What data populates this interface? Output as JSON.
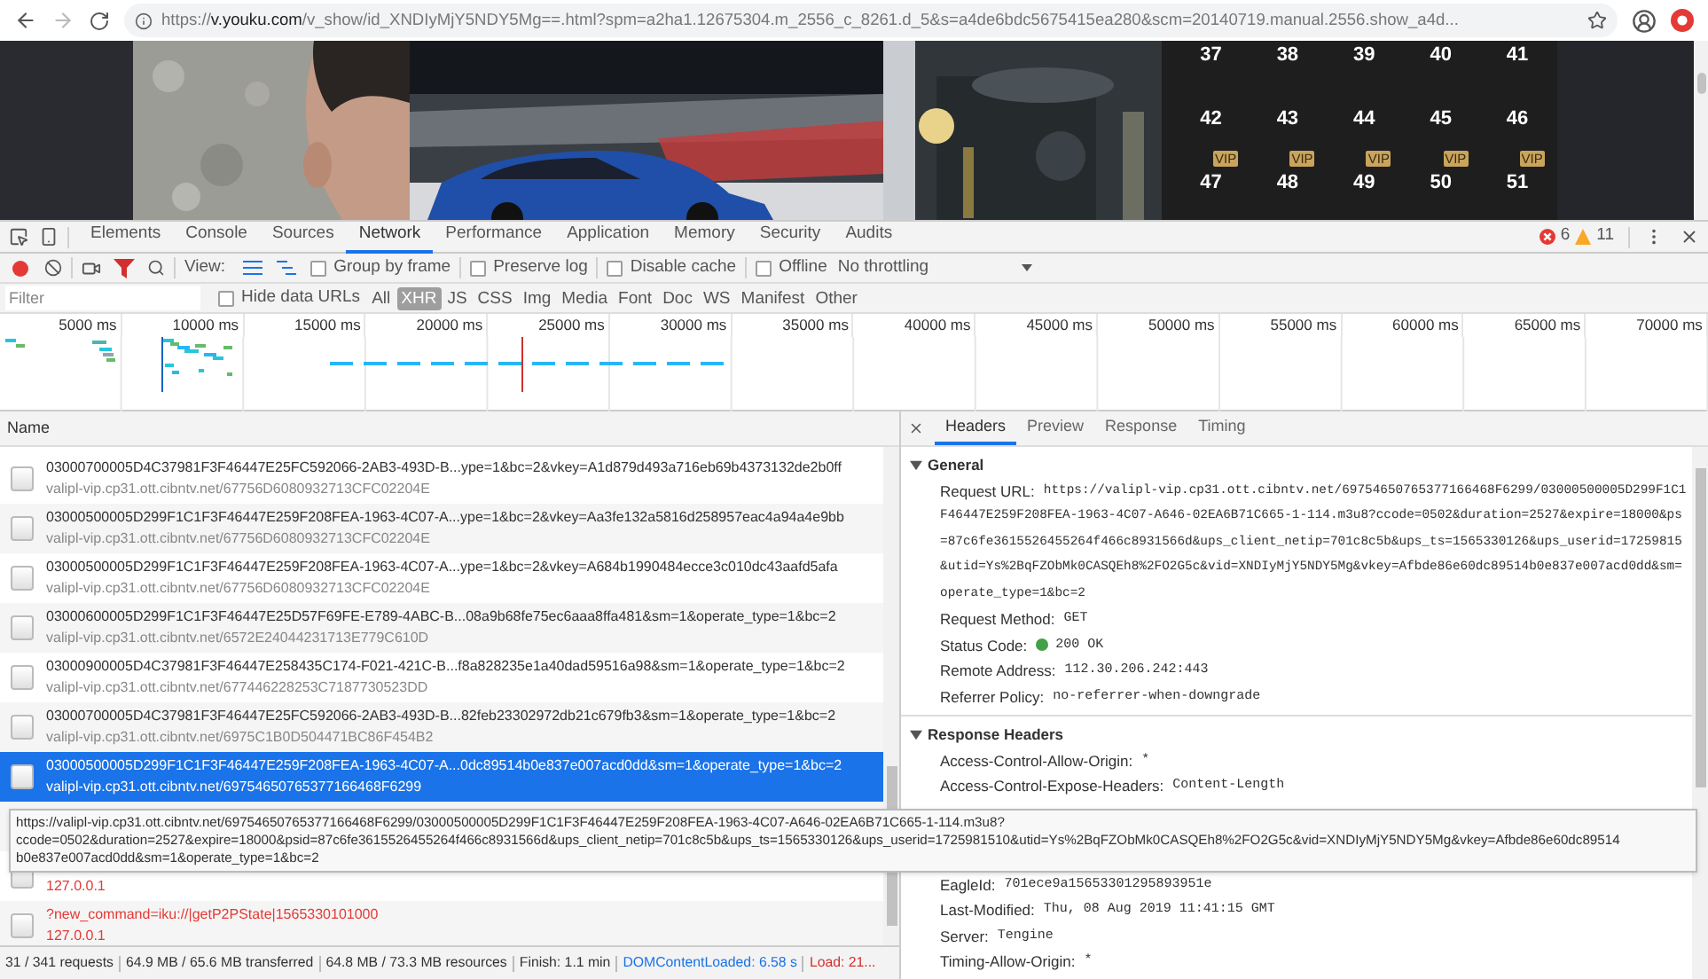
{
  "browser": {
    "url": {
      "scheme": "https://",
      "host": "v.youku.com",
      "rest": "/v_show/id_XNDIyMjY5NDY5Mg==.html?spm=a2ha1.12675304.m_2556_c_8261.d_5&s=a4de6bdc5675415ea280&scm=20140719.manual.2556.show_a4d..."
    }
  },
  "page": {
    "episodes": [
      {
        "number": "37"
      },
      {
        "number": "38"
      },
      {
        "number": "39"
      },
      {
        "number": "40"
      },
      {
        "number": "41"
      },
      {
        "number": "42"
      },
      {
        "number": "43"
      },
      {
        "number": "44"
      },
      {
        "number": "45"
      },
      {
        "number": "46"
      },
      {
        "number": "47",
        "badge": "VIP"
      },
      {
        "number": "48",
        "badge": "VIP"
      },
      {
        "number": "49",
        "badge": "VIP"
      },
      {
        "number": "50",
        "badge": "VIP"
      },
      {
        "number": "51",
        "badge": "VIP"
      }
    ]
  },
  "devtools": {
    "tabs": [
      {
        "label": "Elements",
        "selected": false
      },
      {
        "label": "Console",
        "selected": false
      },
      {
        "label": "Sources",
        "selected": false
      },
      {
        "label": "Network",
        "selected": true
      },
      {
        "label": "Performance",
        "selected": false
      },
      {
        "label": "Application",
        "selected": false
      },
      {
        "label": "Memory",
        "selected": false
      },
      {
        "label": "Security",
        "selected": false
      },
      {
        "label": "Audits",
        "selected": false
      }
    ],
    "errors": "6",
    "warnings": "11",
    "toolbar": {
      "view_label": "View:",
      "options": [
        {
          "label": "Group by frame",
          "checked": false
        },
        {
          "label": "Preserve log",
          "checked": false
        },
        {
          "label": "Disable cache",
          "checked": false
        },
        {
          "label": "Offline",
          "checked": false
        }
      ],
      "throttling": "No throttling"
    },
    "filter": {
      "placeholder": "Filter",
      "hide_data_urls": {
        "label": "Hide data URLs",
        "checked": false
      },
      "types": [
        {
          "label": "All",
          "selected": false
        },
        {
          "label": "XHR",
          "selected": true
        },
        {
          "label": "JS",
          "selected": false
        },
        {
          "label": "CSS",
          "selected": false
        },
        {
          "label": "Img",
          "selected": false
        },
        {
          "label": "Media",
          "selected": false
        },
        {
          "label": "Font",
          "selected": false
        },
        {
          "label": "Doc",
          "selected": false
        },
        {
          "label": "WS",
          "selected": false
        },
        {
          "label": "Manifest",
          "selected": false
        },
        {
          "label": "Other",
          "selected": false
        }
      ]
    },
    "timeline": {
      "ticks": [
        "5000 ms",
        "10000 ms",
        "15000 ms",
        "20000 ms",
        "25000 ms",
        "30000 ms",
        "35000 ms",
        "40000 ms",
        "45000 ms",
        "50000 ms",
        "55000 ms",
        "60000 ms",
        "65000 ms",
        "70000 ms"
      ]
    },
    "requests": {
      "header": "Name",
      "rows": [
        {
          "name": "03000700005D4C37981F3F46447E25FC592066-2AB3-493D-B...ype=1&bc=2&vkey=A1d879d493a716eb69b4373132de2b0ff",
          "domain": "valipl-vip.cp31.ott.cibntv.net/67756D6080932713CFC02204E",
          "selected": false,
          "failed": false
        },
        {
          "name": "03000500005D299F1C1F3F46447E259F208FEA-1963-4C07-A...ype=1&bc=2&vkey=Aa3fe132a5816d258957eac4a94a4e9bb",
          "domain": "valipl-vip.cp31.ott.cibntv.net/67756D6080932713CFC02204E",
          "selected": false,
          "failed": false
        },
        {
          "name": "03000500005D299F1C1F3F46447E259F208FEA-1963-4C07-A...ype=1&bc=2&vkey=A684b1990484ecce3c010dc43aafd5afa",
          "domain": "valipl-vip.cp31.ott.cibntv.net/67756D6080932713CFC02204E",
          "selected": false,
          "failed": false
        },
        {
          "name": "03000600005D299F1C1F3F46447E25D57F69FE-E789-4ABC-B...08a9b68fe75ec6aaa8ffa481&sm=1&operate_type=1&bc=2",
          "domain": "valipl-vip.cp31.ott.cibntv.net/6572E24044231713E779C610D",
          "selected": false,
          "failed": false
        },
        {
          "name": "03000900005D4C37981F3F46447E258435C174-F021-421C-B...f8a828235e1a40dad59516a98&sm=1&operate_type=1&bc=2",
          "domain": "valipl-vip.cp31.ott.cibntv.net/677446228253C7187730523DD",
          "selected": false,
          "failed": false
        },
        {
          "name": "03000700005D4C37981F3F46447E25FC592066-2AB3-493D-B...82feb23302972db21c679fb3&sm=1&operate_type=1&bc=2",
          "domain": "valipl-vip.cp31.ott.cibntv.net/6975C1B0D504471BC86F454B2",
          "selected": false,
          "failed": false
        },
        {
          "name": "03000500005D299F1C1F3F46447E259F208FEA-1963-4C07-A...0dc89514b0e837e007acd0dd&sm=1&operate_type=1&bc=2",
          "domain": "valipl-vip.cp31.ott.cibntv.net/69754650765377166468F6299",
          "selected": true,
          "failed": false
        },
        {
          "selected": false
        },
        {
          "domain": "127.0.0.1",
          "selected": false,
          "failed": true
        },
        {
          "name": "?new_command=iku://|getP2PState|1565330101000",
          "domain": "127.0.0.1",
          "selected": false,
          "failed": true
        }
      ]
    },
    "tooltip": {
      "lines": [
        "https://valipl-vip.cp31.ott.cibntv.net/69754650765377166468F6299/03000500005D299F1C1F3F46447E259F208FEA-1963-4C07-A646-02EA6B71C665-1-114.m3u8?",
        "ccode=0502&duration=2527&expire=18000&psid=87c6fe3615526455264f466c8931566d&ups_client_netip=701c8c5b&ups_ts=1565330126&ups_userid=1725981510&utid=Ys%2BqFZObMk0CASQEh8%2FO2G5c&vid=XNDIyMjY5NDY5Mg&vkey=Afbde86e60dc89514",
        "b0e837e007acd0dd&sm=1&operate_type=1&bc=2"
      ]
    },
    "details": {
      "tabs": [
        {
          "label": "Headers",
          "selected": true
        },
        {
          "label": "Preview",
          "selected": false
        },
        {
          "label": "Response",
          "selected": false
        },
        {
          "label": "Timing",
          "selected": false
        }
      ],
      "general": {
        "title": "General",
        "expanded": true,
        "request_url": {
          "label": "Request URL:",
          "lines": [
            "https://valipl-vip.cp31.ott.cibntv.net/69754650765377166468F6299/03000500005D299F1C1",
            "F46447E259F208FEA-1963-4C07-A646-02EA6B71C665-1-114.m3u8?ccode=0502&duration=2527&expire=18000&ps",
            "=87c6fe3615526455264f466c8931566d&ups_client_netip=701c8c5b&ups_ts=1565330126&ups_userid=17259815",
            "&utid=Ys%2BqFZObMk0CASQEh8%2FO2G5c&vid=XNDIyMjY5NDY5Mg&vkey=Afbde86e60dc89514b0e837e007acd0dd&sm=",
            "operate_type=1&bc=2"
          ]
        },
        "fields": [
          {
            "label": "Request Method:",
            "value": "GET",
            "kind": "plain"
          },
          {
            "label": "Status Code:",
            "value": "200 OK",
            "kind": "status"
          },
          {
            "label": "Remote Address:",
            "value": "112.30.206.242:443",
            "kind": "plain"
          },
          {
            "label": "Referrer Policy:",
            "value": "no-referrer-when-downgrade",
            "kind": "plain"
          }
        ]
      },
      "response_headers": {
        "title": "Response Headers",
        "expanded": true,
        "above_tooltip": [
          {
            "label": "Access-Control-Allow-Origin:",
            "value": "*"
          },
          {
            "label": "Access-Control-Expose-Headers:",
            "value": "Content-Length"
          }
        ],
        "below_tooltip": [
          {
            "label": "EagleId:",
            "value": "701ece9a15653301295893951e"
          },
          {
            "label": "Last-Modified:",
            "value": "Thu, 08 Aug 2019 11:41:15 GMT"
          },
          {
            "label": "Server:",
            "value": "Tengine"
          },
          {
            "label": "Timing-Allow-Origin:",
            "value": "*"
          }
        ]
      }
    },
    "status_bar": [
      {
        "text": "31 / 341 requests",
        "kind": "plain"
      },
      {
        "text": "64.9 MB / 65.6 MB transferred",
        "kind": "plain"
      },
      {
        "text": "64.8 MB / 73.3 MB resources",
        "kind": "plain"
      },
      {
        "text": "Finish: 1.1 min",
        "kind": "plain"
      },
      {
        "text": "DOMContentLoaded: 6.58 s",
        "kind": "dom"
      },
      {
        "text": "Load: 21...",
        "kind": "load"
      }
    ]
  }
}
